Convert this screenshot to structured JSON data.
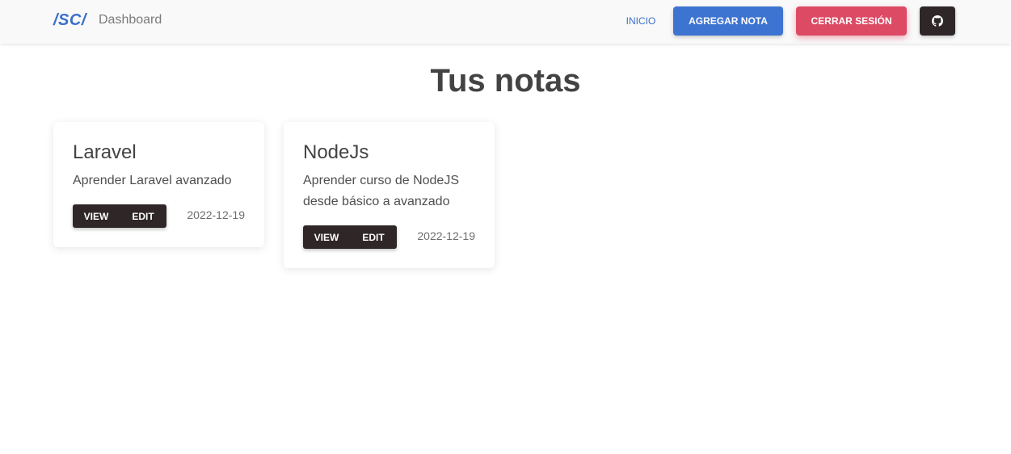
{
  "navbar": {
    "brand": "/SC/",
    "title": "Dashboard",
    "link_home": "INICIO",
    "add_note": "AGREGAR NOTA",
    "logout": "CERRAR SESIÓN",
    "github_icon": "github-icon"
  },
  "main": {
    "title": "Tus notas"
  },
  "notes": [
    {
      "title": "Laravel",
      "description": "Aprender Laravel avanzado",
      "view_label": "VIEW",
      "edit_label": "EDIT",
      "date": "2022-12-19"
    },
    {
      "title": "NodeJs",
      "description": "Aprender curso de NodeJS desde básico a avanzado",
      "view_label": "VIEW",
      "edit_label": "EDIT",
      "date": "2022-12-19"
    }
  ],
  "colors": {
    "primary": "#3e74d1",
    "danger": "#dd4a64",
    "dark": "#2f2727"
  }
}
